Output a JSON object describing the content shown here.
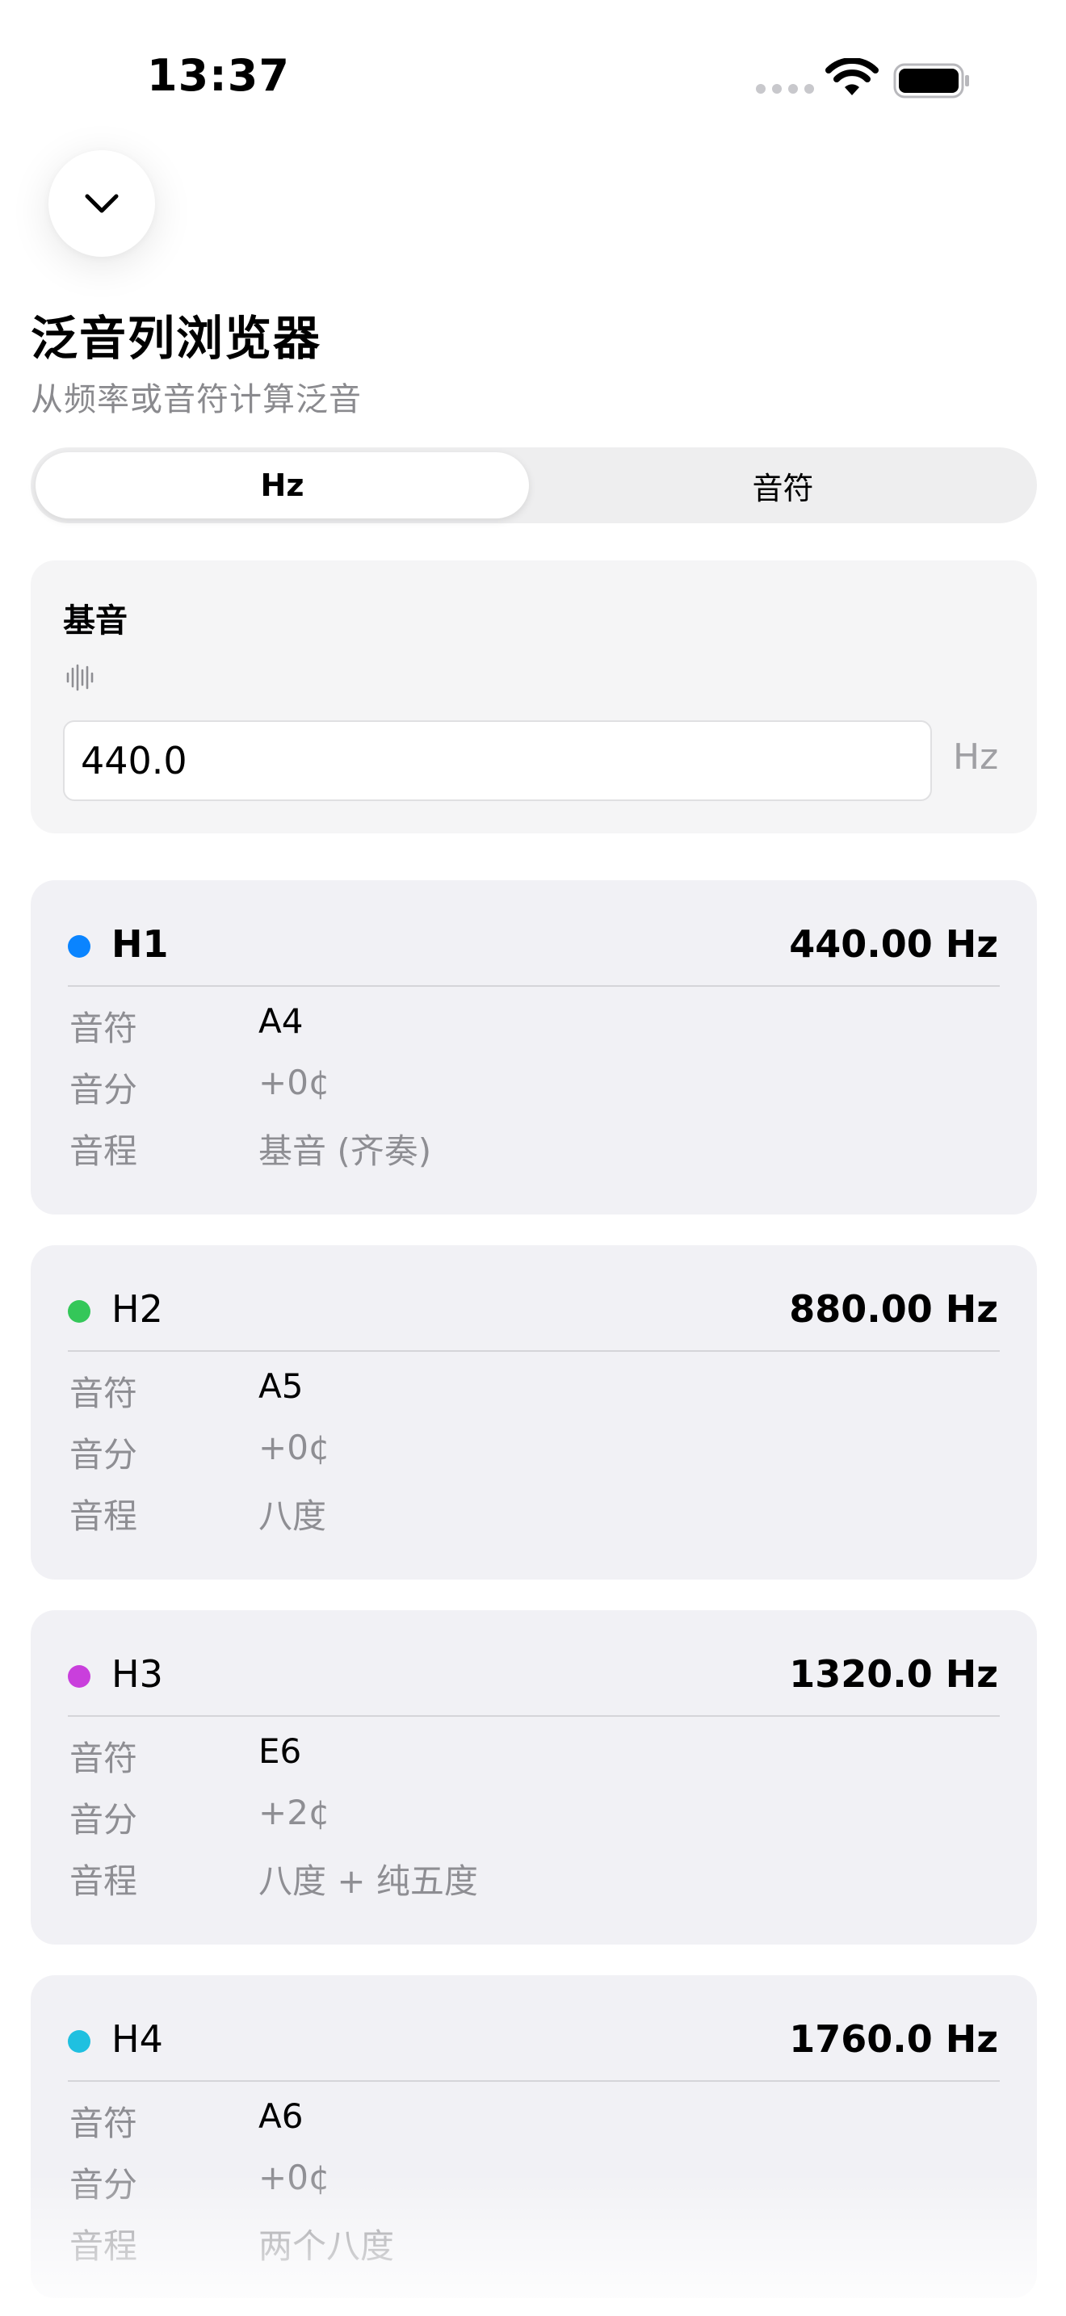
{
  "status_bar": {
    "time": "13:37"
  },
  "header": {
    "title": "泛音列浏览器",
    "subtitle": "从频率或音符计算泛音"
  },
  "mode_selector": {
    "options": [
      "Hz",
      "音符"
    ],
    "selected": "Hz"
  },
  "fundamental": {
    "label": "基音",
    "value": "440.0",
    "unit": "Hz"
  },
  "row_labels": {
    "note": "音符",
    "cents": "音分",
    "interval": "音程"
  },
  "harmonics": [
    {
      "label": "H1",
      "frequency": "440.00 Hz",
      "note": "A4",
      "cents": "+0¢",
      "interval": "基音 (齐奏)",
      "color": "#0a84ff"
    },
    {
      "label": "H2",
      "frequency": "880.00 Hz",
      "note": "A5",
      "cents": "+0¢",
      "interval": "八度",
      "color": "#34c759"
    },
    {
      "label": "H3",
      "frequency": "1320.0 Hz",
      "note": "E6",
      "cents": "+2¢",
      "interval": "八度 + 纯五度",
      "color": "#c93fdc"
    },
    {
      "label": "H4",
      "frequency": "1760.0 Hz",
      "note": "A6",
      "cents": "+0¢",
      "interval": "两个八度",
      "color": "#1fc0e0"
    }
  ]
}
